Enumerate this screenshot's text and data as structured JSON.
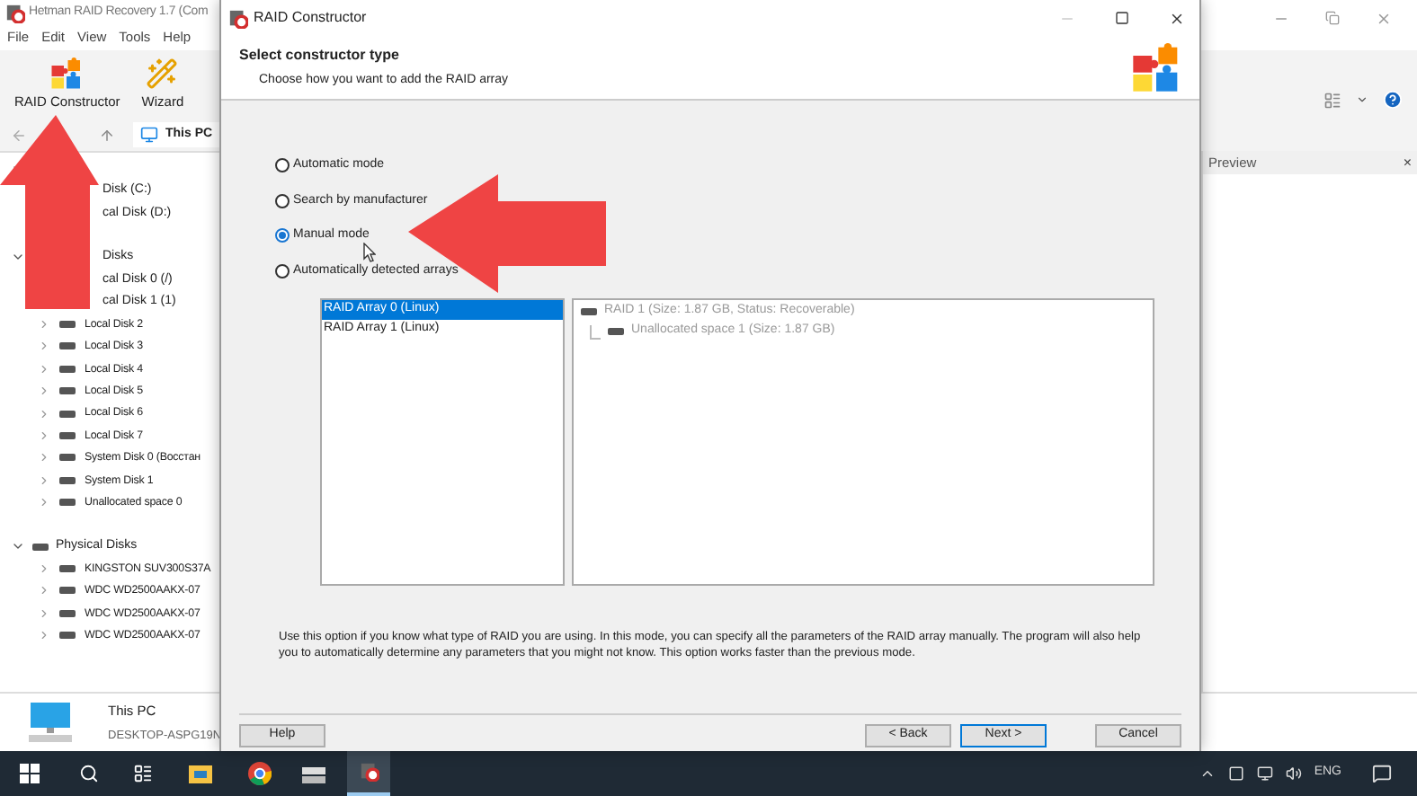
{
  "app_window": {
    "title": "Hetman RAID Recovery 1.7 (Com",
    "menu": [
      "File",
      "Edit",
      "View",
      "Tools",
      "Help"
    ],
    "toolbar": [
      "RAID Constructor",
      "Wizard"
    ],
    "address": "This PC",
    "tree": [
      {
        "kind": "partial",
        "expanded": true,
        "children": [
          {
            "label": "Disk (C:)",
            "kind": "partial"
          },
          {
            "label": "cal Disk (D:)",
            "kind": "partial"
          }
        ]
      },
      {
        "kind": "partial",
        "label": "Disks",
        "expanded": true,
        "children": [
          {
            "label": "cal Disk 0 (/)",
            "kind": "partial"
          },
          {
            "label": "cal Disk 1 (1)",
            "kind": "partial"
          },
          {
            "label": "Local Disk 2",
            "kind": "drive"
          },
          {
            "label": "Local Disk 3",
            "kind": "drive"
          },
          {
            "label": "Local Disk 4",
            "kind": "drive"
          },
          {
            "label": "Local Disk 5",
            "kind": "drive"
          },
          {
            "label": "Local Disk 6",
            "kind": "drive"
          },
          {
            "label": "Local Disk 7",
            "kind": "drive"
          },
          {
            "label": "System Disk 0 (Восстан",
            "kind": "drive"
          },
          {
            "label": "System Disk 1",
            "kind": "drive"
          },
          {
            "label": "Unallocated space 0",
            "kind": "drive"
          }
        ]
      },
      {
        "kind": "full",
        "label": "Physical Disks",
        "expanded": true,
        "children": [
          {
            "label": "KINGSTON SUV300S37A",
            "kind": "drive"
          },
          {
            "label": "WDC WD2500AAKX-07",
            "kind": "drive"
          },
          {
            "label": "WDC WD2500AAKX-07",
            "kind": "drive"
          },
          {
            "label": "WDC WD2500AAKX-07",
            "kind": "drive"
          }
        ]
      }
    ],
    "preview": {
      "title": "Preview",
      "close": "×"
    },
    "footer": {
      "name": "This PC",
      "computer": "DESKTOP-ASPG19N"
    }
  },
  "dialog": {
    "title": "RAID Constructor",
    "heading": "Select constructor type",
    "subheading": "Choose how you want to add the RAID array",
    "modes": [
      {
        "label": "Automatic mode",
        "selected": false
      },
      {
        "label": "Search by manufacturer",
        "selected": false
      },
      {
        "label": "Manual mode",
        "selected": true
      },
      {
        "label": "Automatically detected arrays",
        "selected": false
      }
    ],
    "arrays": [
      {
        "label": "RAID Array 0 (Linux)",
        "selected": true
      },
      {
        "label": "RAID Array 1 (Linux)",
        "selected": false
      }
    ],
    "structure": {
      "disabled": true,
      "items": [
        {
          "label": "RAID 1 (Size: 1.87 GB, Status: Recoverable)",
          "children": [
            {
              "label": "Unallocated space 1 (Size: 1.87 GB)"
            }
          ]
        }
      ]
    },
    "description": "Use this option if you know what type of RAID you are using. In this mode, you can specify all the parameters of the RAID array manually. The program will also help you to automatically determine any parameters that you might not know. This option works faster than the previous mode.",
    "buttons": [
      {
        "label": "Help",
        "kind": "help",
        "focused": false
      },
      {
        "label": "< Back",
        "kind": "nav",
        "focused": false
      },
      {
        "label": "Next >",
        "kind": "nav",
        "focused": true
      },
      {
        "label": "Cancel",
        "kind": "cancel",
        "focused": false
      }
    ]
  },
  "taskbar": {
    "language": "ENG"
  }
}
